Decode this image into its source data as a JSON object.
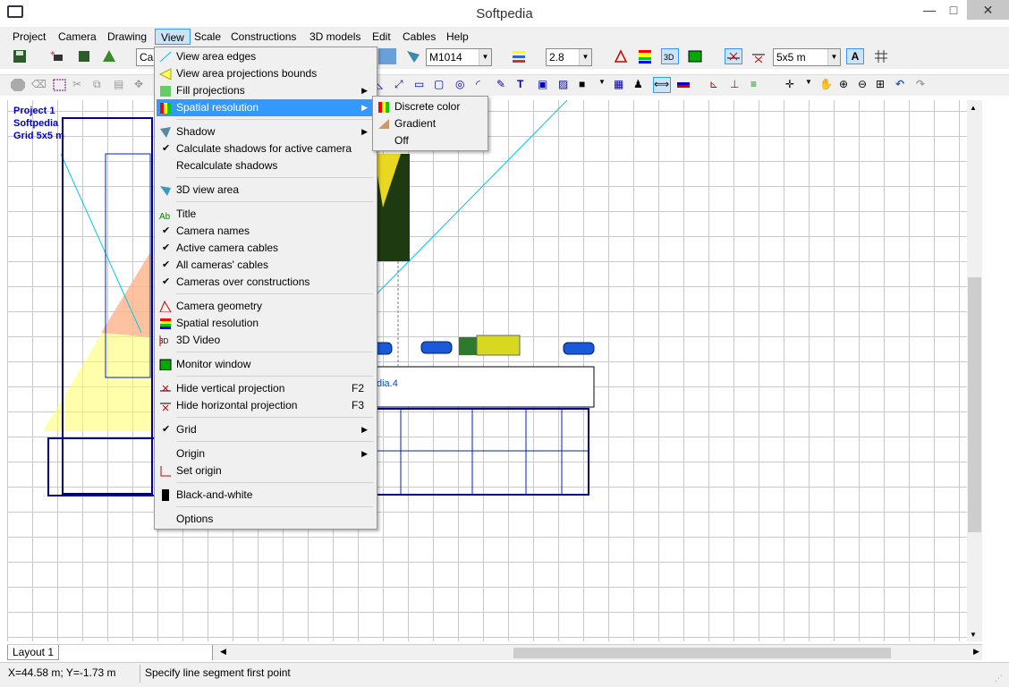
{
  "window": {
    "title": "Softpedia",
    "minimize": "—",
    "maximize": "□",
    "close": "✕"
  },
  "menubar": [
    "Project",
    "Camera",
    "Drawing",
    "View",
    "Scale",
    "Constructions",
    "3D models",
    "Edit",
    "Cables",
    "Help"
  ],
  "toolbar": {
    "camera_combo": "Car",
    "model_combo": "M1014",
    "focal_combo": "2.8",
    "grid_combo": "5x5 m"
  },
  "canvas": {
    "project_lines": [
      "Project 1",
      "Softpedia",
      "Grid 5x5 m"
    ],
    "camera_label": "dia.4"
  },
  "view_menu": [
    {
      "label": "View area edges",
      "icon": "view-area-edges-icon"
    },
    {
      "label": "View area projections bounds",
      "icon": "projection-bounds-icon"
    },
    {
      "label": "Fill projections",
      "icon": "fill-projections-icon",
      "submenu": true
    },
    {
      "label": "Spatial resolution",
      "icon": "spatial-resolution-icon",
      "submenu": true,
      "highlighted": true
    },
    {
      "label": "Shadow",
      "icon": "shadow-icon",
      "submenu": true
    },
    {
      "label": "Calculate shadows for active camera",
      "checked": true
    },
    {
      "label": "Recalculate shadows"
    },
    {
      "label": "3D view area",
      "icon": "3d-view-area-icon"
    },
    {
      "label": "Title",
      "icon": "title-icon"
    },
    {
      "label": "Camera names",
      "checked": true
    },
    {
      "label": "Active camera cables",
      "checked": true
    },
    {
      "label": "All cameras' cables",
      "checked": true
    },
    {
      "label": "Cameras over constructions",
      "checked": true
    },
    {
      "label": "Camera geometry",
      "icon": "camera-geometry-icon"
    },
    {
      "label": "Spatial resolution",
      "icon": "spatial-resolution-icon"
    },
    {
      "label": "3D Video",
      "icon": "3d-video-icon"
    },
    {
      "label": "Monitor window",
      "icon": "monitor-window-icon"
    },
    {
      "label": "Hide vertical projection",
      "icon": "vertical-projection-icon",
      "shortcut": "F2"
    },
    {
      "label": "Hide horizontal projection",
      "icon": "horizontal-projection-icon",
      "shortcut": "F3"
    },
    {
      "label": "Grid",
      "checked": true,
      "submenu": true
    },
    {
      "label": "Origin",
      "submenu": true
    },
    {
      "label": "Set origin",
      "icon": "set-origin-icon"
    },
    {
      "label": "Black-and-white",
      "icon": "black-white-icon"
    },
    {
      "label": "Options"
    }
  ],
  "spatial_submenu": [
    {
      "label": "Discrete color",
      "icon": "discrete-color-icon"
    },
    {
      "label": "Gradient",
      "icon": "gradient-icon"
    },
    {
      "label": "Off"
    }
  ],
  "tabs": {
    "layout": "Layout 1"
  },
  "status": {
    "coords": "X=44.58 m; Y=-1.73 m",
    "hint": "Specify line segment first point"
  },
  "colors": {
    "accent": "#3399ff",
    "highlight_menu": "#cce4f7",
    "project_text": "#0000cc",
    "cyan_line": "#00c8e8"
  }
}
